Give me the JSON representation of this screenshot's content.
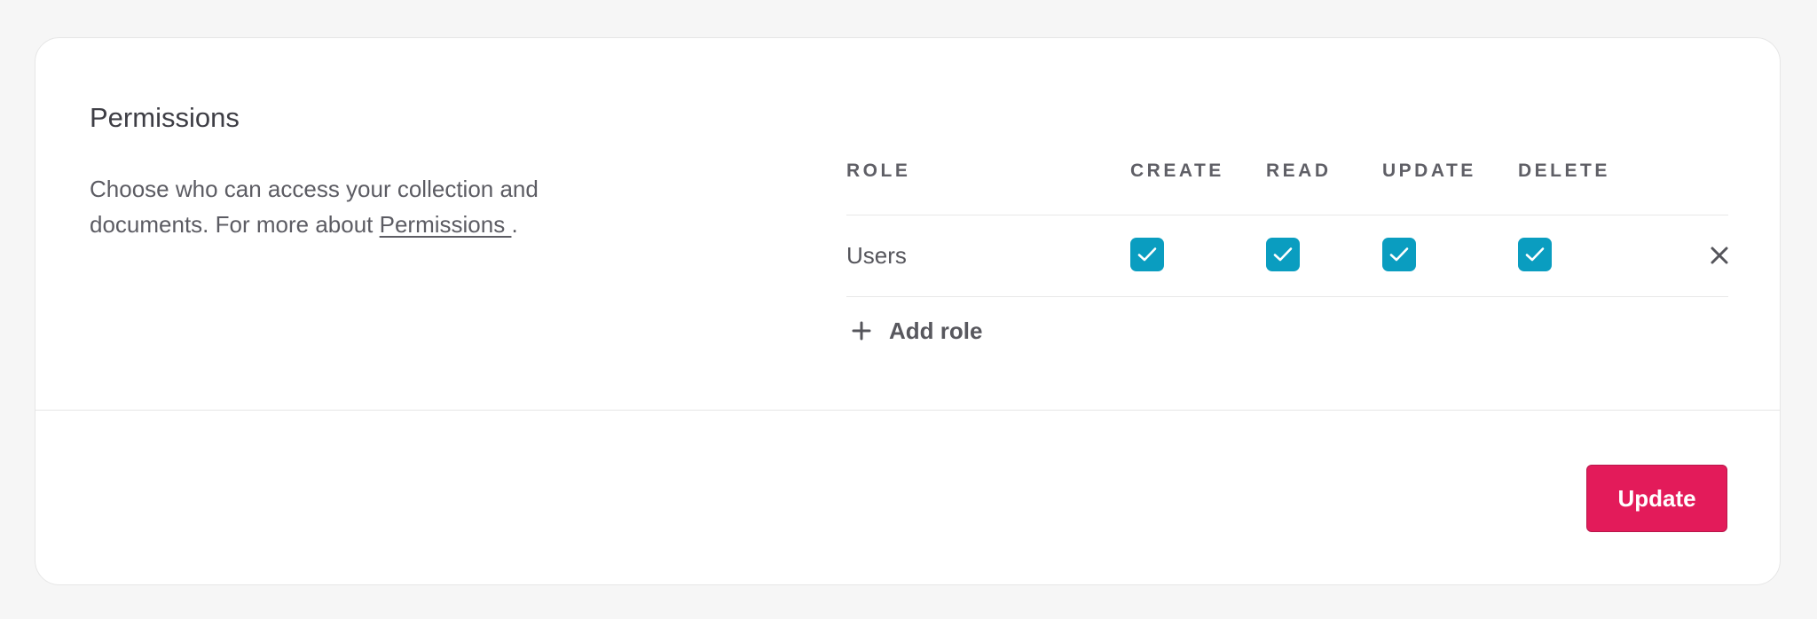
{
  "section": {
    "title": "Permissions",
    "description": "Choose who can access your collection and documents. For more about",
    "link_label": "Permissions ",
    "trailing": "."
  },
  "table": {
    "headers": {
      "role": "ROLE",
      "create": "CREATE",
      "read": "READ",
      "update": "UPDATE",
      "delete": "DELETE"
    },
    "rows": [
      {
        "role": "Users",
        "create": true,
        "read": true,
        "update": true,
        "delete": true,
        "remove_icon": "close-icon"
      }
    ]
  },
  "add_role": {
    "icon": "plus-icon",
    "label": "Add role"
  },
  "footer": {
    "update_label": "Update"
  },
  "colors": {
    "checkbox": "#0a9dc0",
    "primary_button": "#e31b5a",
    "page_background": "#f6f6f6"
  }
}
